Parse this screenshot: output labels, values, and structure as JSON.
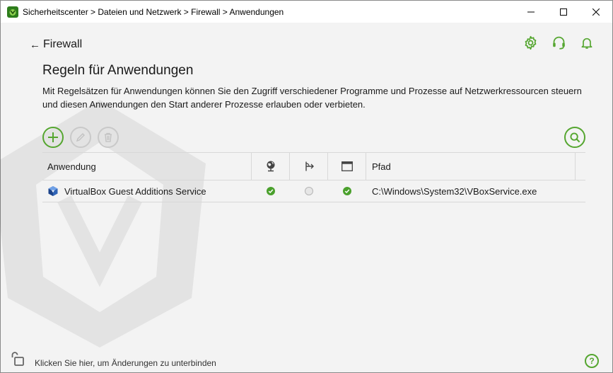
{
  "window": {
    "title": "Sicherheitscenter > Dateien und Netzwerk > Firewall > Anwendungen",
    "icon": "dr-web-spider-icon",
    "controls": [
      "minimize-icon",
      "maximize-icon",
      "close-icon"
    ]
  },
  "header": {
    "back_label": "Firewall",
    "icons": [
      "gear-icon",
      "headset-icon",
      "bell-icon"
    ]
  },
  "main": {
    "title": "Regeln für Anwendungen",
    "description": "Mit Regelsätzen für Anwendungen können Sie den Zugriff verschiedener Programme und Prozesse auf Netzwerkressourcen steuern und diesen Anwendungen den Start anderer Prozesse erlauben oder verbieten.",
    "toolbar": {
      "add": {
        "icon": "plus-icon",
        "enabled": true
      },
      "edit": {
        "icon": "pencil-icon",
        "enabled": false
      },
      "delete": {
        "icon": "trash-icon",
        "enabled": false
      },
      "search": {
        "icon": "search-icon",
        "enabled": true
      }
    },
    "table": {
      "columns": {
        "app": "Anwendung",
        "network": "network-globe-icon",
        "process": "process-start-icon",
        "window": "window-icon",
        "path": "Pfad"
      },
      "rows": [
        {
          "app": "VirtualBox Guest Additions Service",
          "app_icon": "virtualbox-icon",
          "network": "allowed",
          "process": "not-set",
          "window": "allowed",
          "path": "C:\\Windows\\System32\\VBoxService.exe"
        }
      ]
    }
  },
  "footer": {
    "lock_text": "Klicken Sie hier, um Änderungen zu unterbinden",
    "lock_icon": "unlocked-padlock-icon",
    "help_icon": "help-icon",
    "help_label": "?"
  },
  "colors": {
    "accent": "#55a630",
    "allowed": "#4aa02c",
    "background": "#f3f3f3"
  }
}
